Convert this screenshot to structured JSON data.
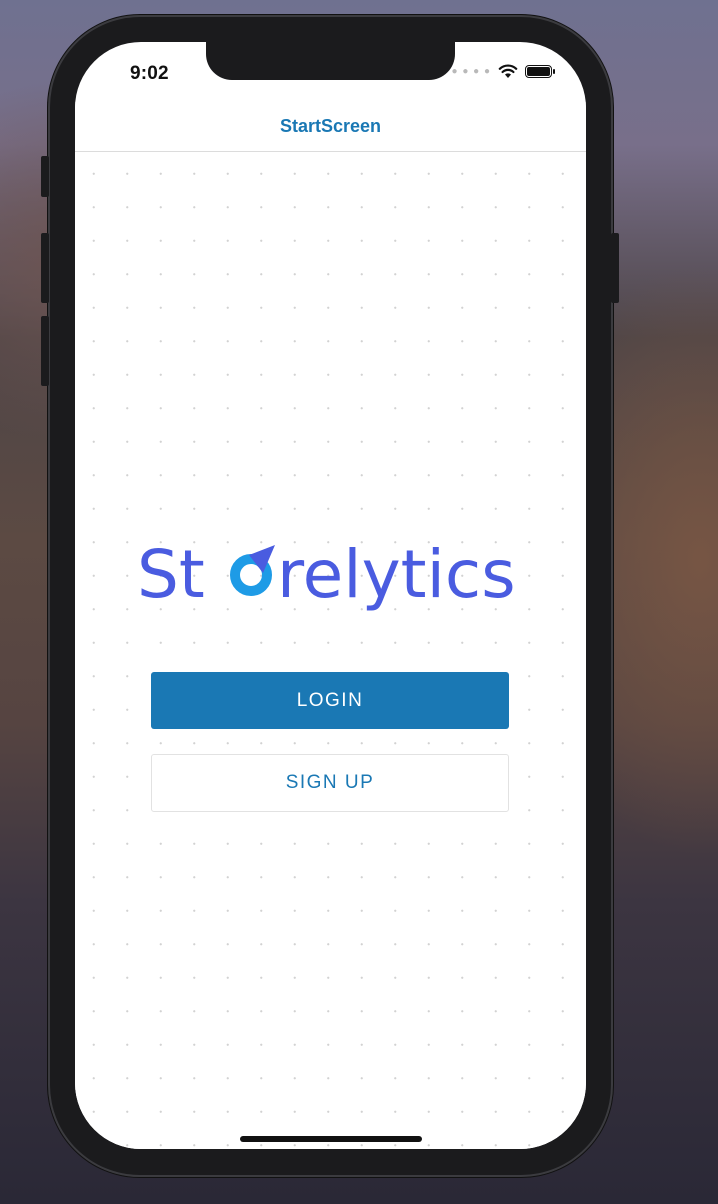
{
  "status_bar": {
    "time": "9:02",
    "signal_icon": "cellular-dots-icon",
    "wifi_icon": "wifi-icon",
    "battery_icon": "battery-icon"
  },
  "nav": {
    "title": "StartScreen"
  },
  "logo": {
    "text_before": "St",
    "text_after": "relytics",
    "icon": "storelytics-o-mark-icon"
  },
  "buttons": {
    "login_label": "LOGIN",
    "signup_label": "SIGN UP"
  },
  "colors": {
    "accent": "#1a78b4",
    "logo_text": "#4a5ce0",
    "logo_mark": "#1e9be6",
    "frame": "#1b1b1d"
  }
}
